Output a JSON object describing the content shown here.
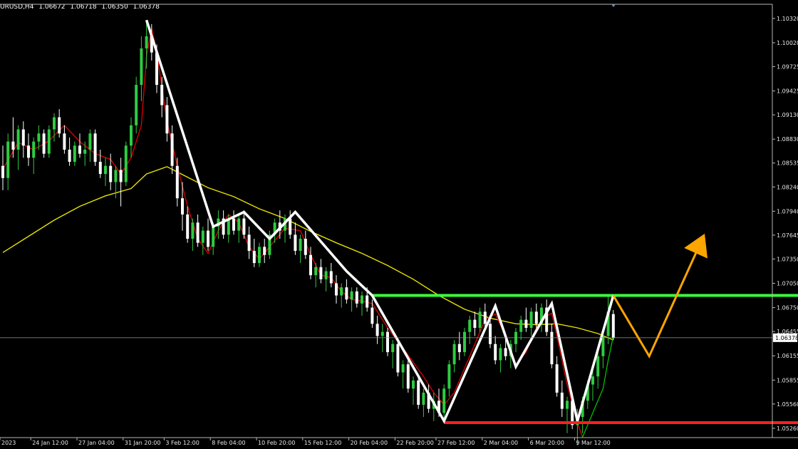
{
  "header": {
    "symbol_timeframe": "URUSD,H4",
    "ohlc": [
      "1.06672",
      "1.06718",
      "1.06350",
      "1.06378"
    ]
  },
  "colors": {
    "background": "#000000",
    "bull_candle": "#2ecc40",
    "bear_candle": "#ffffff",
    "fast_ma": "#e00000",
    "fast_ma2": "#00c000",
    "slow_ma": "#e8e000",
    "zigzag": "#ffffff",
    "resistance": "#3cff3c",
    "support": "#ff1e1e",
    "projection": "#ffa500"
  },
  "chart_data": {
    "type": "line",
    "y_scale": {
      "min": 1.05145,
      "max": 1.10495
    },
    "y_ticks": [
      "1.10320",
      "1.10020",
      "1.09725",
      "1.09425",
      "1.09130",
      "1.08830",
      "1.08535",
      "1.08240",
      "1.07940",
      "1.07645",
      "1.07350",
      "1.07050",
      "1.06750",
      "1.06455",
      "1.06155",
      "1.05855",
      "1.05560",
      "1.05260"
    ],
    "current_price": "1.06378",
    "x_ticks": [
      "2023",
      "24 Jan 12:00",
      "27 Jan 04:00",
      "31 Jan 20:00",
      "3 Feb 12:00",
      "8 Feb 04:00",
      "10 Feb 20:00",
      "15 Feb 12:00",
      "20 Feb 04:00",
      "22 Feb 20:00",
      "27 Feb 12:00",
      "2 Mar 04:00",
      "6 Mar 20:00",
      "9 Mar 12:00"
    ],
    "x_tick_index": [
      0,
      6,
      15,
      24,
      32,
      41,
      50,
      59,
      68,
      77,
      85,
      94,
      103,
      112
    ],
    "bars_visible": 150,
    "zigzag": {
      "name": "",
      "points": [
        [
          28,
          1.103
        ],
        [
          41,
          1.0775
        ],
        [
          47,
          1.0793
        ],
        [
          52,
          1.076
        ],
        [
          57,
          1.0793
        ],
        [
          67,
          1.072
        ],
        [
          72,
          1.069
        ],
        [
          86,
          1.0535
        ],
        [
          96,
          1.0677
        ],
        [
          100,
          1.0602
        ],
        [
          107,
          1.068
        ],
        [
          112,
          1.0535
        ],
        [
          119,
          1.069
        ]
      ]
    },
    "resistance_level": 1.069,
    "support_level": 1.0533,
    "projection": [
      [
        119,
        1.069
      ],
      [
        126,
        1.0615
      ],
      [
        136,
        1.0755
      ]
    ],
    "slow_ma": [
      [
        0,
        1.0743
      ],
      [
        5,
        1.0763
      ],
      [
        10,
        1.0783
      ],
      [
        15,
        1.08
      ],
      [
        20,
        1.0813
      ],
      [
        25,
        1.0822
      ],
      [
        28,
        1.084
      ],
      [
        32,
        1.0849
      ],
      [
        36,
        1.0836
      ],
      [
        40,
        1.0823
      ],
      [
        45,
        1.0812
      ],
      [
        50,
        1.0797
      ],
      [
        55,
        1.0785
      ],
      [
        60,
        1.0769
      ],
      [
        65,
        1.0755
      ],
      [
        70,
        1.0742
      ],
      [
        75,
        1.0727
      ],
      [
        80,
        1.071
      ],
      [
        85,
        1.069
      ],
      [
        90,
        1.0673
      ],
      [
        95,
        1.0662
      ],
      [
        100,
        1.0655
      ],
      [
        104,
        1.0654
      ],
      [
        108,
        1.0655
      ],
      [
        112,
        1.065
      ],
      [
        116,
        1.0643
      ],
      [
        119,
        1.0635
      ]
    ],
    "fast_ma": [
      [
        0,
        1.0846
      ],
      [
        3,
        1.0879
      ],
      [
        6,
        1.087
      ],
      [
        9,
        1.0881
      ],
      [
        12,
        1.09
      ],
      [
        15,
        1.088
      ],
      [
        18,
        1.0865
      ],
      [
        21,
        1.0858
      ],
      [
        23,
        1.084
      ],
      [
        25,
        1.086
      ],
      [
        27,
        1.09
      ],
      [
        28,
        1.0985
      ],
      [
        29,
        1.102
      ],
      [
        30,
        1.099
      ],
      [
        32,
        1.0905
      ],
      [
        34,
        1.085
      ],
      [
        36,
        1.08
      ],
      [
        38,
        1.076
      ],
      [
        40,
        1.0742
      ],
      [
        42,
        1.077
      ],
      [
        44,
        1.079
      ],
      [
        46,
        1.078
      ],
      [
        48,
        1.075
      ],
      [
        50,
        1.0735
      ],
      [
        52,
        1.075
      ],
      [
        55,
        1.0773
      ],
      [
        58,
        1.077
      ],
      [
        60,
        1.074
      ],
      [
        62,
        1.0715
      ],
      [
        64,
        1.0712
      ],
      [
        66,
        1.0695
      ],
      [
        68,
        1.0685
      ],
      [
        70,
        1.0683
      ],
      [
        72,
        1.068
      ],
      [
        75,
        1.065
      ],
      [
        78,
        1.0625
      ],
      [
        82,
        1.059
      ],
      [
        84,
        1.057
      ],
      [
        86,
        1.0555
      ],
      [
        88,
        1.057
      ],
      [
        90,
        1.06
      ],
      [
        92,
        1.063
      ],
      [
        94,
        1.066
      ],
      [
        96,
        1.0667
      ],
      [
        98,
        1.064
      ],
      [
        100,
        1.0605
      ],
      [
        102,
        1.062
      ],
      [
        104,
        1.065
      ],
      [
        106,
        1.0665
      ],
      [
        107,
        1.0668
      ],
      [
        108,
        1.064
      ],
      [
        110,
        1.058
      ],
      [
        112,
        1.0533
      ],
      [
        113,
        1.0515
      ]
    ],
    "fast_ma2": [
      [
        113,
        1.0515
      ],
      [
        115,
        1.0545
      ],
      [
        117,
        1.0575
      ],
      [
        118,
        1.061
      ],
      [
        119,
        1.064
      ]
    ],
    "candles": [
      [
        0,
        1.085,
        1.0875,
        1.082,
        1.0835
      ],
      [
        1,
        1.0835,
        1.089,
        1.082,
        1.088
      ],
      [
        2,
        1.088,
        1.091,
        1.086,
        1.087
      ],
      [
        3,
        1.087,
        1.09,
        1.0845,
        1.0895
      ],
      [
        4,
        1.0895,
        1.0905,
        1.086,
        1.0875
      ],
      [
        5,
        1.0875,
        1.089,
        1.085,
        1.086
      ],
      [
        6,
        1.086,
        1.0885,
        1.084,
        1.088
      ],
      [
        7,
        1.088,
        1.09,
        1.087,
        1.089
      ],
      [
        8,
        1.089,
        1.0895,
        1.086,
        1.0865
      ],
      [
        9,
        1.0865,
        1.09,
        1.086,
        1.0895
      ],
      [
        10,
        1.0895,
        1.0915,
        1.088,
        1.091
      ],
      [
        11,
        1.091,
        1.092,
        1.0885,
        1.089
      ],
      [
        12,
        1.089,
        1.09,
        1.0865,
        1.087
      ],
      [
        13,
        1.087,
        1.0885,
        1.085,
        1.0855
      ],
      [
        14,
        1.0855,
        1.088,
        1.085,
        1.0875
      ],
      [
        15,
        1.0875,
        1.089,
        1.086,
        1.0865
      ],
      [
        16,
        1.0865,
        1.088,
        1.085,
        1.087
      ],
      [
        17,
        1.087,
        1.0895,
        1.0855,
        1.089
      ],
      [
        18,
        1.089,
        1.0895,
        1.085,
        1.0855
      ],
      [
        19,
        1.0855,
        1.087,
        1.0835,
        1.084
      ],
      [
        20,
        1.084,
        1.086,
        1.0825,
        1.085
      ],
      [
        21,
        1.085,
        1.0865,
        1.082,
        1.083
      ],
      [
        22,
        1.083,
        1.085,
        1.081,
        1.0845
      ],
      [
        23,
        1.0845,
        1.086,
        1.08,
        1.083
      ],
      [
        24,
        1.083,
        1.088,
        1.0825,
        1.0875
      ],
      [
        25,
        1.0875,
        1.091,
        1.086,
        1.09
      ],
      [
        26,
        1.09,
        1.096,
        1.089,
        1.095
      ],
      [
        27,
        1.095,
        1.101,
        1.093,
        1.0995
      ],
      [
        28,
        1.0995,
        1.103,
        1.097,
        1.101
      ],
      [
        29,
        1.101,
        1.1025,
        1.098,
        1.099
      ],
      [
        30,
        1.099,
        1.1,
        1.094,
        1.095
      ],
      [
        31,
        1.095,
        1.096,
        1.091,
        1.0925
      ],
      [
        32,
        1.0925,
        1.0935,
        1.088,
        1.089
      ],
      [
        33,
        1.089,
        1.09,
        1.084,
        1.085
      ],
      [
        34,
        1.085,
        1.086,
        1.08,
        1.081
      ],
      [
        35,
        1.081,
        1.083,
        1.077,
        1.079
      ],
      [
        36,
        1.079,
        1.08,
        1.0755,
        1.076
      ],
      [
        37,
        1.076,
        1.0785,
        1.0745,
        1.078
      ],
      [
        38,
        1.078,
        1.079,
        1.075,
        1.0755
      ],
      [
        39,
        1.0755,
        1.0775,
        1.074,
        1.077
      ],
      [
        40,
        1.077,
        1.0785,
        1.0745,
        1.075
      ],
      [
        41,
        1.075,
        1.078,
        1.074,
        1.0775
      ],
      [
        42,
        1.0775,
        1.0795,
        1.076,
        1.0785
      ],
      [
        43,
        1.0785,
        1.0795,
        1.076,
        1.0765
      ],
      [
        44,
        1.0765,
        1.079,
        1.0755,
        1.0785
      ],
      [
        45,
        1.0785,
        1.0795,
        1.0765,
        1.077
      ],
      [
        46,
        1.077,
        1.079,
        1.0755,
        1.0785
      ],
      [
        47,
        1.0785,
        1.0795,
        1.076,
        1.0765
      ],
      [
        48,
        1.0765,
        1.0775,
        1.0735,
        1.0745
      ],
      [
        49,
        1.0745,
        1.076,
        1.0725,
        1.073
      ],
      [
        50,
        1.073,
        1.0755,
        1.0725,
        1.075
      ],
      [
        51,
        1.075,
        1.076,
        1.073,
        1.074
      ],
      [
        52,
        1.074,
        1.077,
        1.0735,
        1.0765
      ],
      [
        53,
        1.0765,
        1.0785,
        1.0755,
        1.078
      ],
      [
        54,
        1.078,
        1.0795,
        1.076,
        1.077
      ],
      [
        55,
        1.077,
        1.079,
        1.0755,
        1.0785
      ],
      [
        56,
        1.0785,
        1.0795,
        1.076,
        1.0765
      ],
      [
        57,
        1.0765,
        1.078,
        1.074,
        1.0745
      ],
      [
        58,
        1.0745,
        1.0765,
        1.073,
        1.076
      ],
      [
        59,
        1.076,
        1.077,
        1.0735,
        1.074
      ],
      [
        60,
        1.074,
        1.075,
        1.071,
        1.0715
      ],
      [
        61,
        1.0715,
        1.073,
        1.07,
        1.0725
      ],
      [
        62,
        1.0725,
        1.0735,
        1.0705,
        1.071
      ],
      [
        63,
        1.071,
        1.0725,
        1.0695,
        1.072
      ],
      [
        64,
        1.072,
        1.073,
        1.07,
        1.0705
      ],
      [
        65,
        1.0705,
        1.0715,
        1.068,
        1.069
      ],
      [
        66,
        1.069,
        1.0705,
        1.0675,
        1.07
      ],
      [
        67,
        1.07,
        1.071,
        1.068,
        1.0685
      ],
      [
        68,
        1.0685,
        1.07,
        1.067,
        1.0695
      ],
      [
        69,
        1.0695,
        1.07,
        1.0675,
        1.068
      ],
      [
        70,
        1.068,
        1.0695,
        1.0665,
        1.069
      ],
      [
        71,
        1.069,
        1.07,
        1.067,
        1.0675
      ],
      [
        72,
        1.0675,
        1.0685,
        1.065,
        1.0655
      ],
      [
        73,
        1.0655,
        1.0665,
        1.063,
        1.064
      ],
      [
        74,
        1.064,
        1.0655,
        1.062,
        1.0645
      ],
      [
        75,
        1.0645,
        1.065,
        1.0615,
        1.062
      ],
      [
        76,
        1.062,
        1.0635,
        1.06,
        1.063
      ],
      [
        77,
        1.063,
        1.0635,
        1.059,
        1.0595
      ],
      [
        78,
        1.0595,
        1.061,
        1.0575,
        1.0605
      ],
      [
        79,
        1.0605,
        1.061,
        1.057,
        1.0575
      ],
      [
        80,
        1.0575,
        1.059,
        1.0555,
        1.0585
      ],
      [
        81,
        1.0585,
        1.059,
        1.055,
        1.0555
      ],
      [
        82,
        1.0555,
        1.0575,
        1.054,
        1.057
      ],
      [
        83,
        1.057,
        1.058,
        1.0545,
        1.055
      ],
      [
        84,
        1.055,
        1.057,
        1.0535,
        1.056
      ],
      [
        85,
        1.056,
        1.0575,
        1.054,
        1.0545
      ],
      [
        86,
        1.0545,
        1.058,
        1.0535,
        1.0575
      ],
      [
        87,
        1.0575,
        1.061,
        1.0565,
        1.0605
      ],
      [
        88,
        1.0605,
        1.0635,
        1.0595,
        1.063
      ],
      [
        89,
        1.063,
        1.0645,
        1.061,
        1.062
      ],
      [
        90,
        1.062,
        1.065,
        1.0615,
        1.0645
      ],
      [
        91,
        1.0645,
        1.0665,
        1.063,
        1.066
      ],
      [
        92,
        1.066,
        1.067,
        1.064,
        1.065
      ],
      [
        93,
        1.065,
        1.0675,
        1.0645,
        1.067
      ],
      [
        94,
        1.067,
        1.068,
        1.065,
        1.0655
      ],
      [
        95,
        1.0655,
        1.0665,
        1.0625,
        1.063
      ],
      [
        96,
        1.063,
        1.064,
        1.0605,
        1.061
      ],
      [
        97,
        1.061,
        1.063,
        1.0595,
        1.0625
      ],
      [
        98,
        1.0625,
        1.064,
        1.061,
        1.0615
      ],
      [
        99,
        1.0615,
        1.0635,
        1.06,
        1.063
      ],
      [
        100,
        1.063,
        1.065,
        1.062,
        1.0645
      ],
      [
        101,
        1.0645,
        1.0665,
        1.0635,
        1.066
      ],
      [
        102,
        1.066,
        1.0675,
        1.0645,
        1.065
      ],
      [
        103,
        1.065,
        1.0675,
        1.064,
        1.067
      ],
      [
        104,
        1.067,
        1.068,
        1.065,
        1.0655
      ],
      [
        105,
        1.0655,
        1.068,
        1.0645,
        1.0675
      ],
      [
        106,
        1.0675,
        1.0685,
        1.064,
        1.0645
      ],
      [
        107,
        1.0645,
        1.0655,
        1.06,
        1.0605
      ],
      [
        108,
        1.0605,
        1.0615,
        1.0565,
        1.057
      ],
      [
        109,
        1.057,
        1.0585,
        1.054,
        1.055
      ],
      [
        110,
        1.055,
        1.0565,
        1.052,
        1.056
      ],
      [
        111,
        1.056,
        1.057,
        1.0525,
        1.053
      ],
      [
        112,
        1.053,
        1.055,
        1.0505,
        1.054
      ],
      [
        113,
        1.054,
        1.0565,
        1.052,
        1.056
      ],
      [
        114,
        1.056,
        1.0585,
        1.055,
        1.058
      ],
      [
        115,
        1.058,
        1.06,
        1.056,
        1.059
      ],
      [
        116,
        1.059,
        1.062,
        1.0575,
        1.0615
      ],
      [
        117,
        1.0615,
        1.0645,
        1.06,
        1.064
      ],
      [
        118,
        1.064,
        1.069,
        1.063,
        1.067
      ],
      [
        119,
        1.0667,
        1.0672,
        1.0635,
        1.0638
      ]
    ]
  }
}
